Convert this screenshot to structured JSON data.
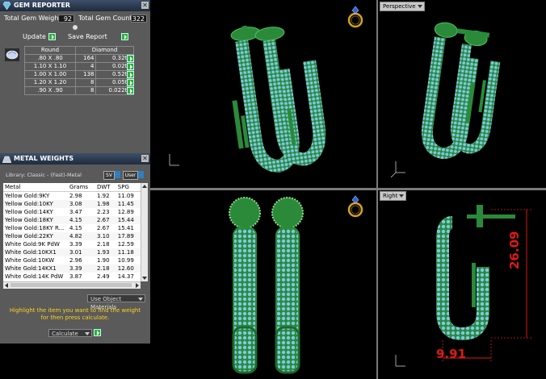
{
  "gem_reporter": {
    "title": "GEM REPORTER",
    "total_weight_label": "Total Gem Weight",
    "total_weight_value": "92",
    "total_count_label": "Total Gem Count",
    "total_count_value": "322",
    "update_label": "Update",
    "save_report_label": "Save Report",
    "table_headers": [
      "Round",
      "Diamond"
    ],
    "rows": [
      {
        "size": ".80 X .80",
        "count": "164",
        "weight": "0.32tw"
      },
      {
        "size": "1.10 X 1.10",
        "count": "4",
        "weight": "0.02tw"
      },
      {
        "size": "1.00 X 1.00",
        "count": "138",
        "weight": "0.52tw"
      },
      {
        "size": "1.20 X 1.20",
        "count": "8",
        "weight": "0.05tw"
      },
      {
        "size": ".90 X .90",
        "count": "8",
        "weight": "0.022tw"
      }
    ]
  },
  "metal_weights": {
    "title": "METAL WEIGHTS",
    "library_label": "Library: Classic - (Fast)-Metal",
    "sv_label": "SV",
    "user_label": "User",
    "headers": [
      "Metal",
      "Grams",
      "DWT",
      "SPG"
    ],
    "rows": [
      {
        "metal": "Yellow Gold:9KY",
        "grams": "2.98",
        "dwt": "1.92",
        "spg": "11.09"
      },
      {
        "metal": "Yellow Gold:10KY",
        "grams": "3.08",
        "dwt": "1.98",
        "spg": "11.45"
      },
      {
        "metal": "Yellow Gold:14KY",
        "grams": "3.47",
        "dwt": "2.23",
        "spg": "12.89"
      },
      {
        "metal": "Yellow Gold:18KY",
        "grams": "4.15",
        "dwt": "2.67",
        "spg": "15.44"
      },
      {
        "metal": "Yellow Gold:18KY R...",
        "grams": "4.15",
        "dwt": "2.67",
        "spg": "15.41"
      },
      {
        "metal": "Yellow Gold:22KY",
        "grams": "4.82",
        "dwt": "3.10",
        "spg": "17.89"
      },
      {
        "metal": "White Gold:9K PdW",
        "grams": "3.39",
        "dwt": "2.18",
        "spg": "12.59"
      },
      {
        "metal": "White Gold:10KX1",
        "grams": "3.01",
        "dwt": "1.93",
        "spg": "11.18"
      },
      {
        "metal": "White Gold:10KW",
        "grams": "2.96",
        "dwt": "1.90",
        "spg": "10.99"
      },
      {
        "metal": "White Gold:14KX1",
        "grams": "3.39",
        "dwt": "2.18",
        "spg": "12.60"
      },
      {
        "metal": "White Gold:14K PdW",
        "grams": "3.87",
        "dwt": "2.49",
        "spg": "14.37"
      }
    ],
    "use_object_materials_label": "Use Object Materials",
    "instruction": "Highlight the item you want to find the weight for then press calculate.",
    "calculate_label": "Calculate"
  },
  "viewports": {
    "perspective_label": "Perspective",
    "right_label": "Right",
    "dimension_height": "26.09",
    "dimension_width": "9.91"
  },
  "colors": {
    "metal_green": "#2a8a3a",
    "gem_blue": "#7ec8e8",
    "dimension_red": "#e01818",
    "panel_gray": "#5a5a5a"
  }
}
